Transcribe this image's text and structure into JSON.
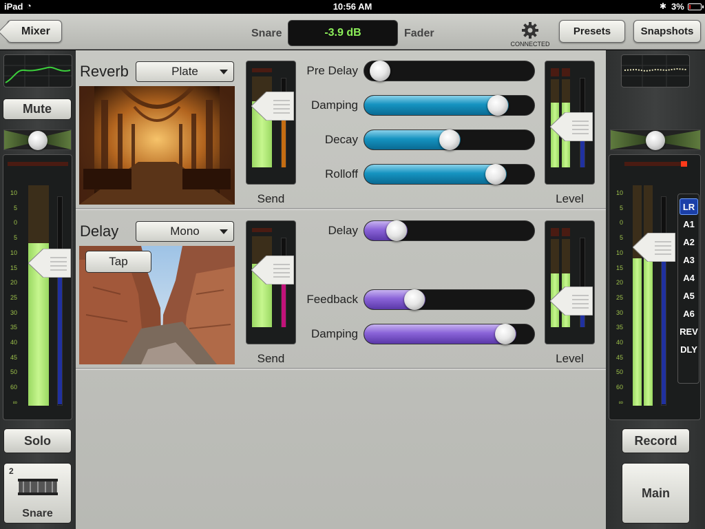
{
  "status_bar": {
    "device": "iPad",
    "time": "10:56 AM",
    "battery": "3%"
  },
  "header": {
    "back_label": "Mixer",
    "channel_name": "Snare",
    "fader_value": "-3.9 dB",
    "fader_label": "Fader",
    "connection_status": "CONNECTED",
    "presets_label": "Presets",
    "snapshots_label": "Snapshots"
  },
  "left_strip": {
    "mute_label": "Mute",
    "solo_label": "Solo",
    "channel_number": "2",
    "channel_label": "Snare",
    "scale": [
      "10",
      "5",
      "0",
      "5",
      "10",
      "15",
      "20",
      "25",
      "30",
      "35",
      "40",
      "45",
      "50",
      "60",
      "∞"
    ],
    "fader_level": 0.77
  },
  "right_strip": {
    "record_label": "Record",
    "main_label": "Main",
    "scale": [
      "10",
      "5",
      "0",
      "5",
      "10",
      "15",
      "20",
      "25",
      "30",
      "35",
      "40",
      "45",
      "50",
      "60",
      "∞"
    ],
    "buses": [
      "LR",
      "A1",
      "A2",
      "A3",
      "A4",
      "A5",
      "A6",
      "REV",
      "DLY"
    ],
    "active_bus": "LR"
  },
  "reverb": {
    "title": "Reverb",
    "type": "Plate",
    "send_label": "Send",
    "level_label": "Level",
    "params": [
      {
        "label": "Pre Delay",
        "value": 0.04
      },
      {
        "label": "Damping",
        "value": 0.82
      },
      {
        "label": "Decay",
        "value": 0.5
      },
      {
        "label": "Rolloff",
        "value": 0.81
      }
    ]
  },
  "delay": {
    "title": "Delay",
    "type": "Mono",
    "tap_label": "Tap",
    "send_label": "Send",
    "level_label": "Level",
    "params": [
      {
        "label": "Delay",
        "value": 0.15
      },
      {
        "label": "Feedback",
        "value": 0.27
      },
      {
        "label": "Damping",
        "value": 0.87
      }
    ]
  },
  "colors": {
    "display_green": "#8df05a",
    "reverb_accent": "#1593c0",
    "delay_accent": "#8a63d8",
    "meter_green": "#9ad862",
    "bus_active": "#1b3fa8"
  }
}
